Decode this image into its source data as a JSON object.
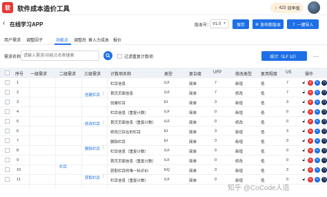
{
  "app": {
    "logo_text": "软",
    "title": "软件成本造价工具",
    "coins_value": "423",
    "coins_label": "效率值"
  },
  "project": {
    "name": "在线学习APP",
    "version_label": "版本号：",
    "version_value": "V1.0",
    "save_label": "保存",
    "publish_label": "发布新版本",
    "import_label": "一键导入"
  },
  "tabs": [
    {
      "label": "用户需求"
    },
    {
      "label": "调整因子"
    },
    {
      "label": "功能点"
    },
    {
      "label": "调整后"
    },
    {
      "label": "章入力成本"
    },
    {
      "label": "报价"
    }
  ],
  "search": {
    "label": "需求名称",
    "placeholder": "请输入需求/功能点名称搜索",
    "filter_label": "过滤重复计数项",
    "stats_label": "统计（ILF 10）"
  },
  "table": {
    "headers": {
      "index": "序号",
      "level1": "一级需求",
      "level2": "二级需求",
      "level3": "三级需求",
      "item": "计数项名称",
      "type": "类型",
      "complexity": "复杂度",
      "ufp": "UFP",
      "change": "修改类型",
      "reuse": "复用程度",
      "us": "US",
      "ops": "操作"
    },
    "level2_value": "栏目",
    "level3_groups": [
      "创建栏目",
      "修改栏目",
      "删除栏目",
      "获取栏目"
    ],
    "rows": [
      {
        "index": "1",
        "item": "栏目信息",
        "type": "ILF",
        "complexity": "简单",
        "ufp": "7",
        "change": "新增",
        "reuse": "低",
        "us": "7"
      },
      {
        "index": "2",
        "item": "首页页面信息",
        "type": "ILF",
        "complexity": "简单",
        "ufp": "7",
        "change": "修改",
        "reuse": "低",
        "us": "7"
      },
      {
        "index": "3",
        "item": "创建栏目",
        "type": "EI",
        "complexity": "简单",
        "ufp": "3",
        "change": "新增",
        "reuse": "低",
        "us": "3"
      },
      {
        "index": "4",
        "item": "栏目信息（重复计数）",
        "type": "ILF",
        "complexity": "简单",
        "ufp": "0",
        "change": "新增",
        "reuse": "低",
        "us": "0"
      },
      {
        "index": "5",
        "item": "首页页面信息（重复计数）",
        "type": "ILF",
        "complexity": "简单",
        "ufp": "0",
        "change": "修改",
        "reuse": "低",
        "us": "0"
      },
      {
        "index": "6",
        "item": "修改已存在的栏目",
        "type": "EI",
        "complexity": "简单",
        "ufp": "3",
        "change": "新增",
        "reuse": "低",
        "us": "3"
      },
      {
        "index": "7",
        "item": "删除栏目",
        "type": "EI",
        "complexity": "简单",
        "ufp": "3",
        "change": "新增",
        "reuse": "低",
        "us": "3"
      },
      {
        "index": "8",
        "item": "栏目信息（重复计数）",
        "type": "ILF",
        "complexity": "简单",
        "ufp": "0",
        "change": "新增",
        "reuse": "低",
        "us": "0"
      },
      {
        "index": "9",
        "item": "首页页面信息（重复计数）",
        "type": "ILF",
        "complexity": "简单",
        "ufp": "0",
        "change": "修改",
        "reuse": "低",
        "us": "0"
      },
      {
        "index": "10",
        "item": "获取栏目的唯一标识ID",
        "type": "EQ",
        "complexity": "简单",
        "ufp": "3",
        "change": "新增",
        "reuse": "低",
        "us": "3"
      },
      {
        "index": "11",
        "item": "栏目信息（重复计数）",
        "type": "ILF",
        "complexity": "简单",
        "ufp": "0",
        "change": "新增",
        "reuse": "低",
        "us": "0"
      }
    ]
  },
  "watermark": "知乎 @CoCode人造",
  "colors": {
    "accent": "#1e6fe6",
    "logo": "#e53935",
    "header_bg": "#eef1f5"
  },
  "icons": [
    "back-arrow-icon",
    "search-icon",
    "coin-icon",
    "lock-icon",
    "delete-icon",
    "edit-icon",
    "copy-icon",
    "more-icon"
  ]
}
